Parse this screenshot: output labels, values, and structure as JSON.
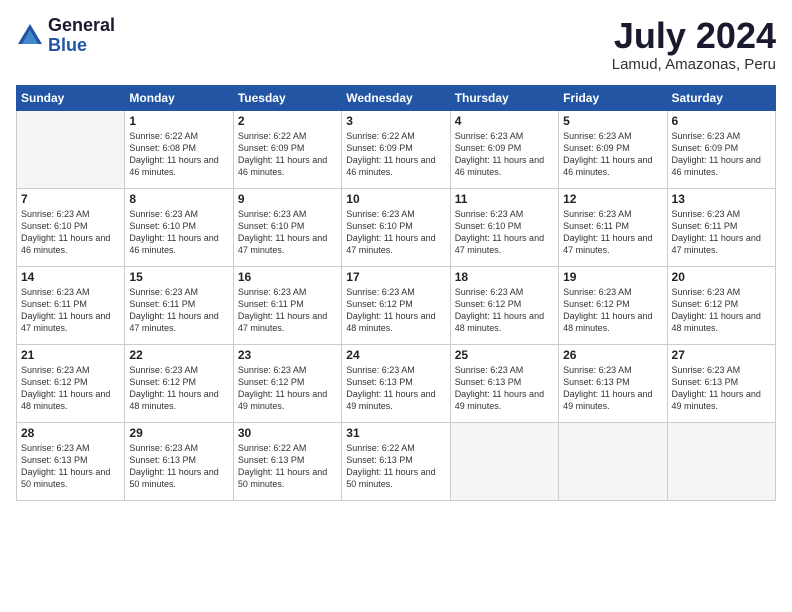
{
  "header": {
    "logo_general": "General",
    "logo_blue": "Blue",
    "month_title": "July 2024",
    "location": "Lamud, Amazonas, Peru"
  },
  "weekdays": [
    "Sunday",
    "Monday",
    "Tuesday",
    "Wednesday",
    "Thursday",
    "Friday",
    "Saturday"
  ],
  "weeks": [
    [
      {
        "day": "",
        "sunrise": "",
        "sunset": "",
        "daylight": ""
      },
      {
        "day": "1",
        "sunrise": "6:22 AM",
        "sunset": "6:08 PM",
        "daylight": "11 hours and 46 minutes."
      },
      {
        "day": "2",
        "sunrise": "6:22 AM",
        "sunset": "6:09 PM",
        "daylight": "11 hours and 46 minutes."
      },
      {
        "day": "3",
        "sunrise": "6:22 AM",
        "sunset": "6:09 PM",
        "daylight": "11 hours and 46 minutes."
      },
      {
        "day": "4",
        "sunrise": "6:23 AM",
        "sunset": "6:09 PM",
        "daylight": "11 hours and 46 minutes."
      },
      {
        "day": "5",
        "sunrise": "6:23 AM",
        "sunset": "6:09 PM",
        "daylight": "11 hours and 46 minutes."
      },
      {
        "day": "6",
        "sunrise": "6:23 AM",
        "sunset": "6:09 PM",
        "daylight": "11 hours and 46 minutes."
      }
    ],
    [
      {
        "day": "7",
        "sunrise": "6:23 AM",
        "sunset": "6:10 PM",
        "daylight": "11 hours and 46 minutes."
      },
      {
        "day": "8",
        "sunrise": "6:23 AM",
        "sunset": "6:10 PM",
        "daylight": "11 hours and 46 minutes."
      },
      {
        "day": "9",
        "sunrise": "6:23 AM",
        "sunset": "6:10 PM",
        "daylight": "11 hours and 47 minutes."
      },
      {
        "day": "10",
        "sunrise": "6:23 AM",
        "sunset": "6:10 PM",
        "daylight": "11 hours and 47 minutes."
      },
      {
        "day": "11",
        "sunrise": "6:23 AM",
        "sunset": "6:10 PM",
        "daylight": "11 hours and 47 minutes."
      },
      {
        "day": "12",
        "sunrise": "6:23 AM",
        "sunset": "6:11 PM",
        "daylight": "11 hours and 47 minutes."
      },
      {
        "day": "13",
        "sunrise": "6:23 AM",
        "sunset": "6:11 PM",
        "daylight": "11 hours and 47 minutes."
      }
    ],
    [
      {
        "day": "14",
        "sunrise": "6:23 AM",
        "sunset": "6:11 PM",
        "daylight": "11 hours and 47 minutes."
      },
      {
        "day": "15",
        "sunrise": "6:23 AM",
        "sunset": "6:11 PM",
        "daylight": "11 hours and 47 minutes."
      },
      {
        "day": "16",
        "sunrise": "6:23 AM",
        "sunset": "6:11 PM",
        "daylight": "11 hours and 47 minutes."
      },
      {
        "day": "17",
        "sunrise": "6:23 AM",
        "sunset": "6:12 PM",
        "daylight": "11 hours and 48 minutes."
      },
      {
        "day": "18",
        "sunrise": "6:23 AM",
        "sunset": "6:12 PM",
        "daylight": "11 hours and 48 minutes."
      },
      {
        "day": "19",
        "sunrise": "6:23 AM",
        "sunset": "6:12 PM",
        "daylight": "11 hours and 48 minutes."
      },
      {
        "day": "20",
        "sunrise": "6:23 AM",
        "sunset": "6:12 PM",
        "daylight": "11 hours and 48 minutes."
      }
    ],
    [
      {
        "day": "21",
        "sunrise": "6:23 AM",
        "sunset": "6:12 PM",
        "daylight": "11 hours and 48 minutes."
      },
      {
        "day": "22",
        "sunrise": "6:23 AM",
        "sunset": "6:12 PM",
        "daylight": "11 hours and 48 minutes."
      },
      {
        "day": "23",
        "sunrise": "6:23 AM",
        "sunset": "6:12 PM",
        "daylight": "11 hours and 49 minutes."
      },
      {
        "day": "24",
        "sunrise": "6:23 AM",
        "sunset": "6:13 PM",
        "daylight": "11 hours and 49 minutes."
      },
      {
        "day": "25",
        "sunrise": "6:23 AM",
        "sunset": "6:13 PM",
        "daylight": "11 hours and 49 minutes."
      },
      {
        "day": "26",
        "sunrise": "6:23 AM",
        "sunset": "6:13 PM",
        "daylight": "11 hours and 49 minutes."
      },
      {
        "day": "27",
        "sunrise": "6:23 AM",
        "sunset": "6:13 PM",
        "daylight": "11 hours and 49 minutes."
      }
    ],
    [
      {
        "day": "28",
        "sunrise": "6:23 AM",
        "sunset": "6:13 PM",
        "daylight": "11 hours and 50 minutes."
      },
      {
        "day": "29",
        "sunrise": "6:23 AM",
        "sunset": "6:13 PM",
        "daylight": "11 hours and 50 minutes."
      },
      {
        "day": "30",
        "sunrise": "6:22 AM",
        "sunset": "6:13 PM",
        "daylight": "11 hours and 50 minutes."
      },
      {
        "day": "31",
        "sunrise": "6:22 AM",
        "sunset": "6:13 PM",
        "daylight": "11 hours and 50 minutes."
      },
      {
        "day": "",
        "sunrise": "",
        "sunset": "",
        "daylight": ""
      },
      {
        "day": "",
        "sunrise": "",
        "sunset": "",
        "daylight": ""
      },
      {
        "day": "",
        "sunrise": "",
        "sunset": "",
        "daylight": ""
      }
    ]
  ]
}
